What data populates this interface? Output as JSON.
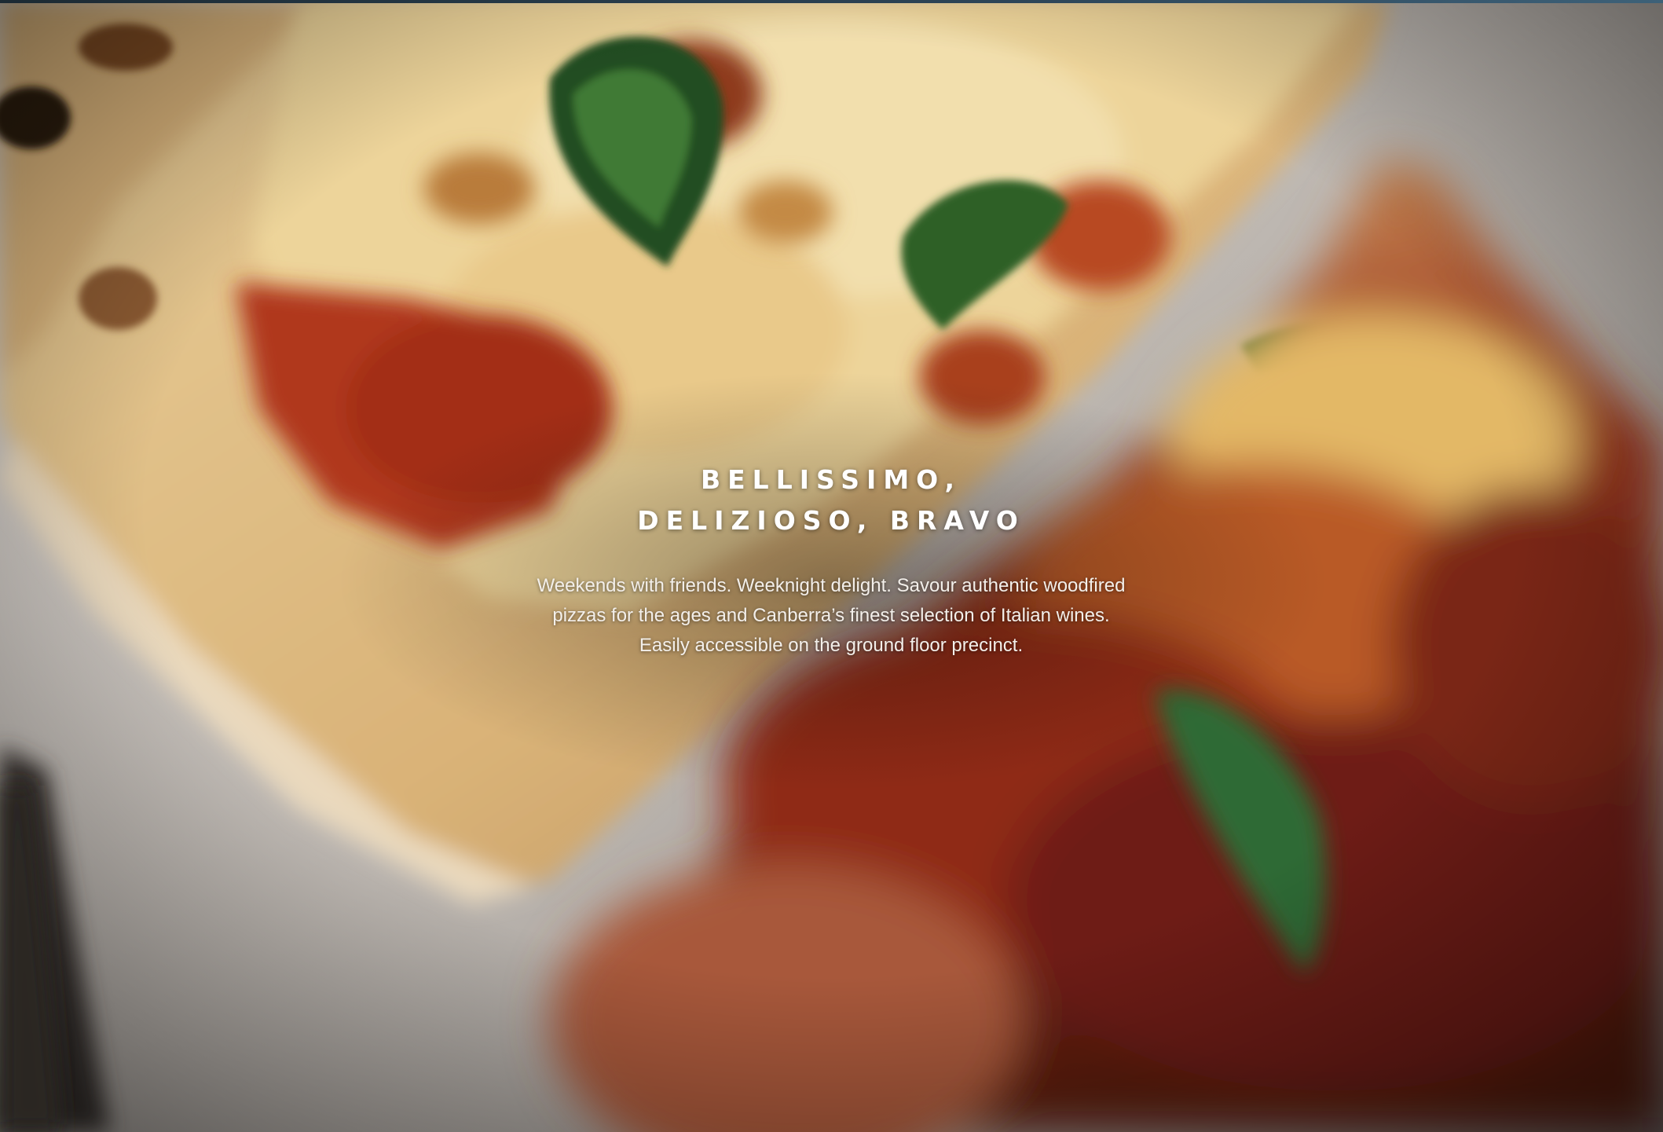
{
  "hero": {
    "headline_line1": "BELLISSIMO,",
    "headline_line2": "DELIZIOSO, BRAVO",
    "description_line1": "Weekends with friends. Weeknight delight. Savour authentic woodfired",
    "description_line2": "pizzas for the ages and Canberra’s finest selection of Italian wines.",
    "description_line3": "Easily accessible on the ground floor precinct."
  },
  "colors": {
    "background_dark": "#1a1210",
    "paper": "#cfcac4",
    "crust": "#d6b58a",
    "cheese": "#e8c882",
    "sauce": "#a8321d",
    "basil": "#2f5d2b",
    "text": "#ffffff",
    "top_strip": "#2c4457"
  },
  "background_image": "pizza-slices-photo"
}
